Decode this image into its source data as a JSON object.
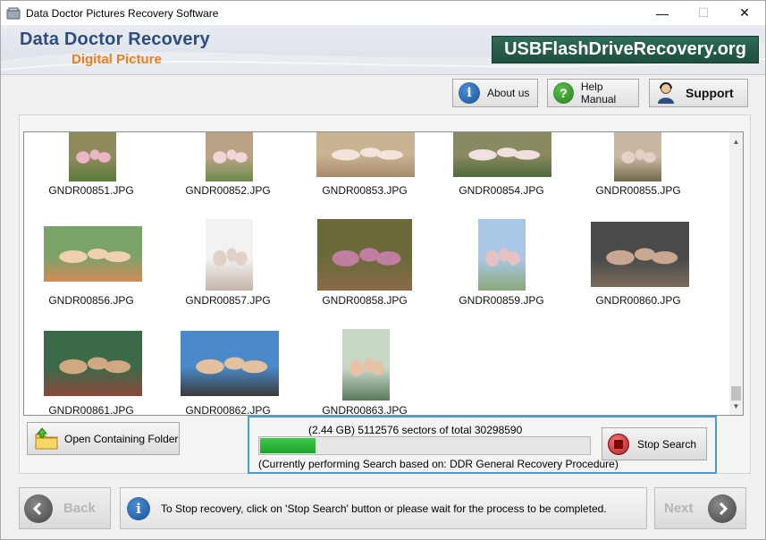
{
  "window": {
    "title": "Data Doctor Pictures Recovery Software",
    "controls": {
      "minimize": "—",
      "maximize": "☐",
      "close": "✕"
    }
  },
  "header": {
    "brand_main": "Data Doctor Recovery",
    "brand_sub": "Digital Picture",
    "site_badge": "USBFlashDriveRecovery.org"
  },
  "toolbar": {
    "about_label": "About us",
    "help_label": "Help Manual",
    "support_label": "Support"
  },
  "gallery": {
    "files": [
      {
        "name": "GNDR00851.JPG",
        "colors": [
          "#8f8a5c",
          "#e8b7c5",
          "#5a7a3a"
        ]
      },
      {
        "name": "GNDR00852.JPG",
        "colors": [
          "#b9a384",
          "#f0d7d7",
          "#6c8a4a"
        ]
      },
      {
        "name": "GNDR00853.JPG",
        "colors": [
          "#c8b392",
          "#f3e3da",
          "#a78c6c"
        ]
      },
      {
        "name": "GNDR00854.JPG",
        "colors": [
          "#8a8a62",
          "#f0e0e0",
          "#4f6a3a"
        ]
      },
      {
        "name": "GNDR00855.JPG",
        "colors": [
          "#c9b7a1",
          "#e6cfc4",
          "#6f6a4a"
        ]
      },
      {
        "name": "GNDR00856.JPG",
        "colors": [
          "#7aa36a",
          "#f1d0b0",
          "#d48a55"
        ]
      },
      {
        "name": "GNDR00857.JPG",
        "colors": [
          "#f2f2f2",
          "#e0d0c8",
          "#c5b4a8"
        ]
      },
      {
        "name": "GNDR00858.JPG",
        "colors": [
          "#6a6a3a",
          "#c07ea0",
          "#8b6a4a"
        ]
      },
      {
        "name": "GNDR00859.JPG",
        "colors": [
          "#a9c8e6",
          "#e8c2c2",
          "#8aa87a"
        ]
      },
      {
        "name": "GNDR00860.JPG",
        "colors": [
          "#4a4a4a",
          "#c8a890",
          "#7a6a5a"
        ]
      },
      {
        "name": "GNDR00861.JPG",
        "colors": [
          "#3a6a4a",
          "#d2a882",
          "#8a4a3a"
        ]
      },
      {
        "name": "GNDR00862.JPG",
        "colors": [
          "#4a8acb",
          "#e2c0a0",
          "#3a3a3a"
        ]
      },
      {
        "name": "GNDR00863.JPG",
        "colors": [
          "#c8d6c6",
          "#e6c2a6",
          "#5a7a5a"
        ]
      }
    ]
  },
  "open_folder_label": "Open Containing Folder",
  "progress": {
    "sectors_text": "(2.44 GB) 5112576  sectors  of  total 30298590",
    "fraction": 0.169,
    "status_text": "(Currently performing Search based on:  DDR General Recovery Procedure)",
    "stop_label": "Stop Search"
  },
  "footer": {
    "back_label": "Back",
    "next_label": "Next",
    "info_text": "To Stop recovery, click on 'Stop Search' button or please wait for the process to be completed."
  }
}
